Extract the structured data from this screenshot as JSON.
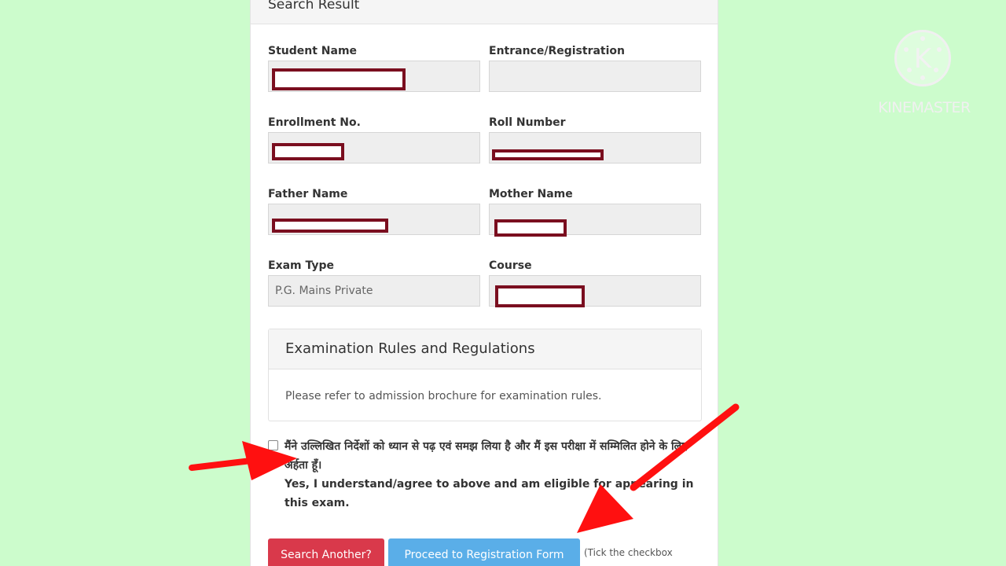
{
  "header": {
    "title": "Search Result"
  },
  "fields": {
    "student_name": {
      "label": "Student Name",
      "value": ""
    },
    "entrance_registration": {
      "label": "Entrance/Registration",
      "value": ""
    },
    "enrollment_no": {
      "label": "Enrollment No.",
      "value": ""
    },
    "roll_number": {
      "label": "Roll Number",
      "value": ""
    },
    "father_name": {
      "label": "Father Name",
      "value": ""
    },
    "mother_name": {
      "label": "Mother Name",
      "value": ""
    },
    "exam_type": {
      "label": "Exam Type",
      "value": "P.G. Mains Private"
    },
    "course": {
      "label": "Course",
      "value": ""
    }
  },
  "rules_panel": {
    "title": "Examination Rules and Regulations",
    "body": "Please refer to admission brochure for examination rules."
  },
  "agreement": {
    "hindi": "मैंने उल्लिखित निर्देशों को ध्यान से पढ़ एवं समझ लिया है और मैं इस परीक्षा में सम्मिलित होने के लिए अर्हता हूँ।",
    "english": "Yes, I understand/agree to above and am eligible for appearing in this exam."
  },
  "buttons": {
    "search_another": "Search Another?",
    "proceed": "Proceed to Registration Form"
  },
  "hint": "(Tick the checkbox",
  "watermark": {
    "brand": "KINEMASTER",
    "icon": "kinemaster-logo-icon"
  },
  "colors": {
    "background": "#ccfccc",
    "danger": "#d9394b",
    "primary": "#5aaee8",
    "redaction": "#7a0e1f",
    "annotation_arrow": "#ff1010"
  }
}
